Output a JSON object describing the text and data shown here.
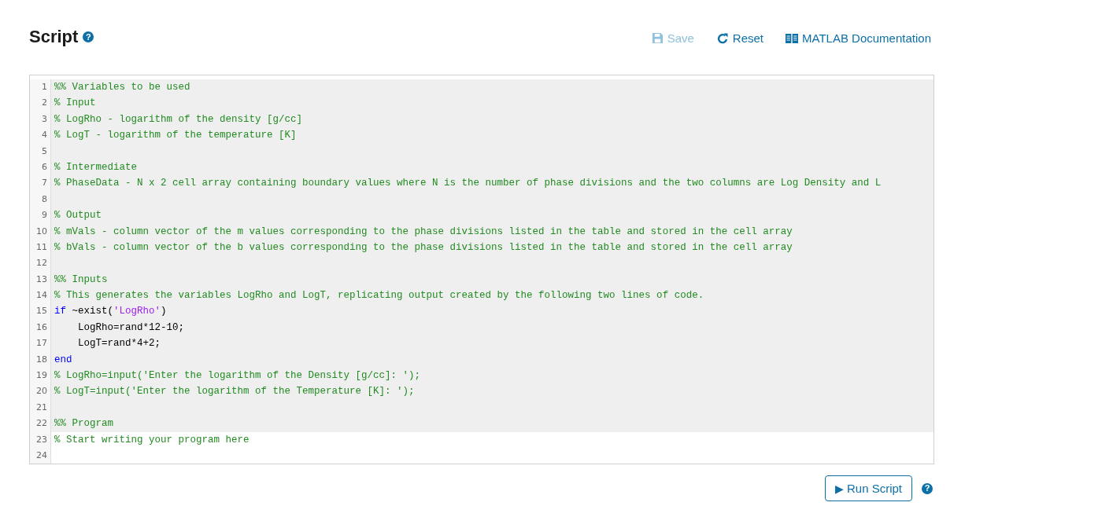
{
  "header": {
    "title": "Script",
    "help": "?"
  },
  "actions": [
    {
      "kind": "save",
      "label": "Save",
      "disabled": true
    },
    {
      "kind": "reset",
      "label": "Reset",
      "disabled": false
    },
    {
      "kind": "docs",
      "label": "MATLAB Documentation",
      "disabled": false
    }
  ],
  "editor": {
    "lines": [
      {
        "number": "1",
        "highlighted": true,
        "tokens": [
          {
            "kind": "comment",
            "text": "%% Variables to be used"
          }
        ]
      },
      {
        "number": "2",
        "highlighted": true,
        "tokens": [
          {
            "kind": "comment",
            "text": "% Input"
          }
        ]
      },
      {
        "number": "3",
        "highlighted": true,
        "tokens": [
          {
            "kind": "comment",
            "text": "% LogRho - logarithm of the density [g/cc]"
          }
        ]
      },
      {
        "number": "4",
        "highlighted": true,
        "tokens": [
          {
            "kind": "comment",
            "text": "% LogT - logarithm of the temperature [K]"
          }
        ]
      },
      {
        "number": "5",
        "highlighted": true
      },
      {
        "number": "6",
        "highlighted": true,
        "tokens": [
          {
            "kind": "comment",
            "text": "% Intermediate"
          }
        ]
      },
      {
        "number": "7",
        "highlighted": true,
        "tokens": [
          {
            "kind": "comment",
            "text": "% PhaseData - N x 2 cell array containing boundary values where N is the number of phase divisions and the two columns are Log Density and L"
          }
        ]
      },
      {
        "number": "8",
        "highlighted": true
      },
      {
        "number": "9",
        "highlighted": true,
        "tokens": [
          {
            "kind": "comment",
            "text": "% Output"
          }
        ]
      },
      {
        "number": "10",
        "highlighted": true,
        "tokens": [
          {
            "kind": "comment",
            "text": "% mVals - column vector of the m values corresponding to the phase divisions listed in the table and stored in the cell array"
          }
        ]
      },
      {
        "number": "11",
        "highlighted": true,
        "tokens": [
          {
            "kind": "comment",
            "text": "% bVals - column vector of the b values corresponding to the phase divisions listed in the table and stored in the cell array"
          }
        ]
      },
      {
        "number": "12",
        "highlighted": true
      },
      {
        "number": "13",
        "highlighted": true,
        "tokens": [
          {
            "kind": "comment",
            "text": "%% Inputs"
          }
        ]
      },
      {
        "number": "14",
        "highlighted": true,
        "tokens": [
          {
            "kind": "comment",
            "text": "% This generates the variables LogRho and LogT, replicating output created by the following two lines of code."
          }
        ]
      },
      {
        "number": "15",
        "highlighted": true,
        "tokens": [
          {
            "kind": "keyword",
            "text": "if"
          },
          {
            "kind": "plain",
            "text": " ~exist("
          },
          {
            "kind": "string",
            "text": "'LogRho'"
          },
          {
            "kind": "plain",
            "text": ")"
          }
        ]
      },
      {
        "number": "16",
        "highlighted": true,
        "tokens": [
          {
            "kind": "plain",
            "text": "    LogRho=rand*12-10;"
          }
        ]
      },
      {
        "number": "17",
        "highlighted": true,
        "tokens": [
          {
            "kind": "plain",
            "text": "    LogT=rand*4+2;"
          }
        ]
      },
      {
        "number": "18",
        "highlighted": true,
        "tokens": [
          {
            "kind": "keyword",
            "text": "end"
          }
        ]
      },
      {
        "number": "19",
        "highlighted": true,
        "tokens": [
          {
            "kind": "comment",
            "text": "% LogRho=input('Enter the logarithm of the Density [g/cc]: ');"
          }
        ]
      },
      {
        "number": "20",
        "highlighted": true,
        "tokens": [
          {
            "kind": "comment",
            "text": "% LogT=input('Enter the logarithm of the Temperature [K]: ');"
          }
        ]
      },
      {
        "number": "21",
        "highlighted": true
      },
      {
        "number": "22",
        "highlighted": true,
        "tokens": [
          {
            "kind": "comment",
            "text": "%% Program"
          }
        ]
      },
      {
        "number": "23",
        "highlighted": false,
        "tokens": [
          {
            "kind": "comment",
            "text": "% Start writing your program here"
          }
        ]
      },
      {
        "number": "24",
        "highlighted": false
      }
    ]
  },
  "run_button": {
    "label": "Run Script",
    "icon": "▶"
  },
  "run_help": "?"
}
